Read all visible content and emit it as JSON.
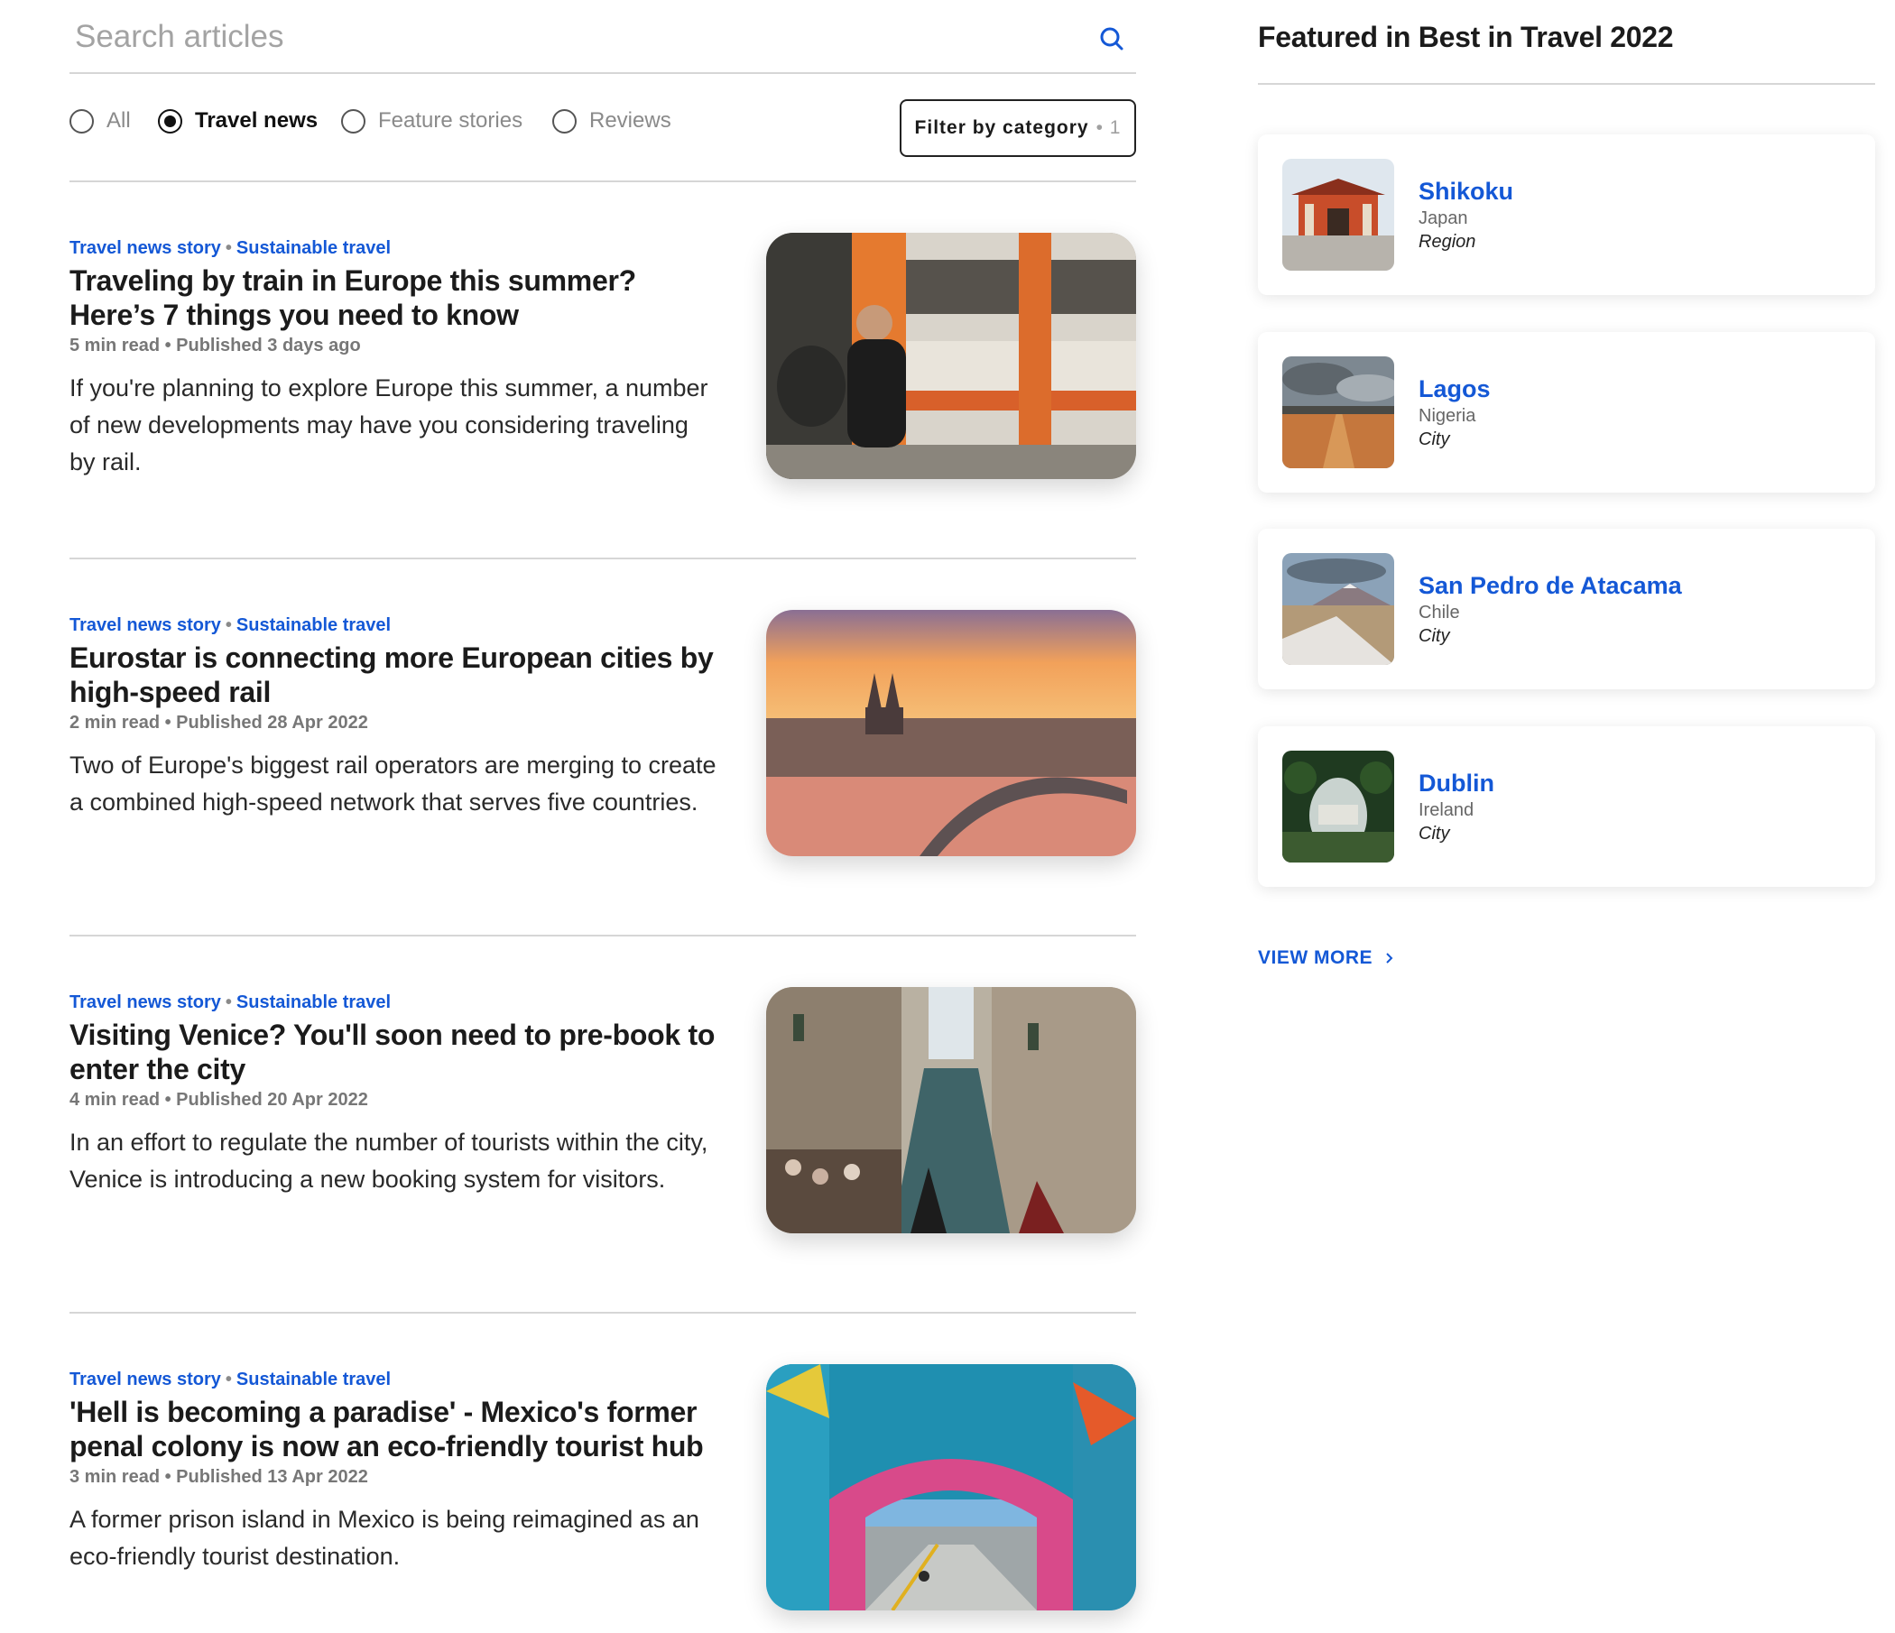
{
  "search": {
    "placeholder": "Search articles",
    "icon": "search-icon"
  },
  "filters": {
    "options": [
      "All",
      "Travel news",
      "Feature stories",
      "Reviews"
    ],
    "selected": "Travel news",
    "category_button": {
      "label": "Filter by category",
      "count": "• 1"
    }
  },
  "articles": [
    {
      "tag1": "Travel news story",
      "separator": "•",
      "tag2": "Sustainable travel",
      "title": "Traveling by train in Europe this summer? Here’s 7 things you need to know",
      "meta": "5 min read • Published 3 days ago",
      "description": "If you're planning to explore Europe this summer, a number of new developments may have you considering traveling by rail."
    },
    {
      "tag1": "Travel news story",
      "separator": "•",
      "tag2": "Sustainable travel",
      "title": "Eurostar is connecting more European cities by high-speed rail",
      "meta": "2 min read • Published 28 Apr 2022",
      "description": "Two of Europe's biggest rail operators are merging to create a combined high-speed network that serves five countries."
    },
    {
      "tag1": "Travel news story",
      "separator": "•",
      "tag2": "Sustainable travel",
      "title": "Visiting Venice? You'll soon need to pre-book to enter the city",
      "meta": "4 min read • Published 20 Apr 2022",
      "description": "In an effort to regulate the number of tourists within the city, Venice is introducing a new booking system for visitors."
    },
    {
      "tag1": "Travel news story",
      "separator": "•",
      "tag2": "Sustainable travel",
      "title": "'Hell is becoming a paradise' - Mexico's former penal colony is now an eco-friendly tourist hub",
      "meta": "3 min read • Published 13 Apr 2022",
      "description": "A former prison island in Mexico is being reimagined as an eco-friendly tourist destination."
    }
  ],
  "sidebar": {
    "title": "Featured in Best in Travel 2022",
    "places": [
      {
        "name": "Shikoku",
        "country": "Japan",
        "type": "Region"
      },
      {
        "name": "Lagos",
        "country": "Nigeria",
        "type": "City"
      },
      {
        "name": "San Pedro de Atacama",
        "country": "Chile",
        "type": "City"
      },
      {
        "name": "Dublin",
        "country": "Ireland",
        "type": "City"
      }
    ],
    "view_more": "VIEW MORE",
    "view_more_icon": "chevron-right-icon"
  },
  "colors": {
    "accent": "#1458d6",
    "text": "#1b1b1b",
    "muted": "#777777",
    "divider": "#d6d6d6"
  }
}
